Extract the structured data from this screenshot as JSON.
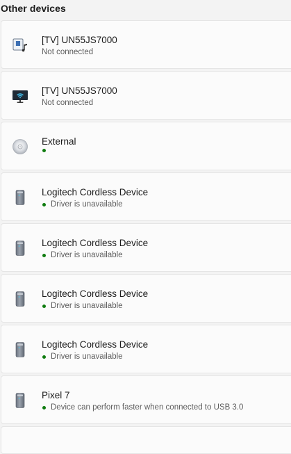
{
  "section": {
    "title": "Other devices"
  },
  "colors": {
    "status_ok": "#0f7b0f",
    "card_bg": "#fbfbfb",
    "page_bg": "#f3f3f3"
  },
  "devices": [
    {
      "name": "[TV] UN55JS7000",
      "status": "Not connected",
      "icon": "media-device-icon",
      "dot": false
    },
    {
      "name": "[TV] UN55JS7000",
      "status": "Not connected",
      "icon": "wireless-display-icon",
      "dot": false
    },
    {
      "name": "External",
      "status": "",
      "icon": "optical-disc-icon",
      "dot": true
    },
    {
      "name": "Logitech Cordless Device",
      "status": "Driver is unavailable",
      "icon": "generic-device-icon",
      "dot": true
    },
    {
      "name": "Logitech Cordless Device",
      "status": "Driver is unavailable",
      "icon": "generic-device-icon",
      "dot": true
    },
    {
      "name": "Logitech Cordless Device",
      "status": "Driver is unavailable",
      "icon": "generic-device-icon",
      "dot": true
    },
    {
      "name": "Logitech Cordless Device",
      "status": "Driver is unavailable",
      "icon": "generic-device-icon",
      "dot": true
    },
    {
      "name": "Pixel 7",
      "status": "Device can perform faster when connected to USB 3.0",
      "icon": "generic-device-icon",
      "dot": true
    }
  ]
}
